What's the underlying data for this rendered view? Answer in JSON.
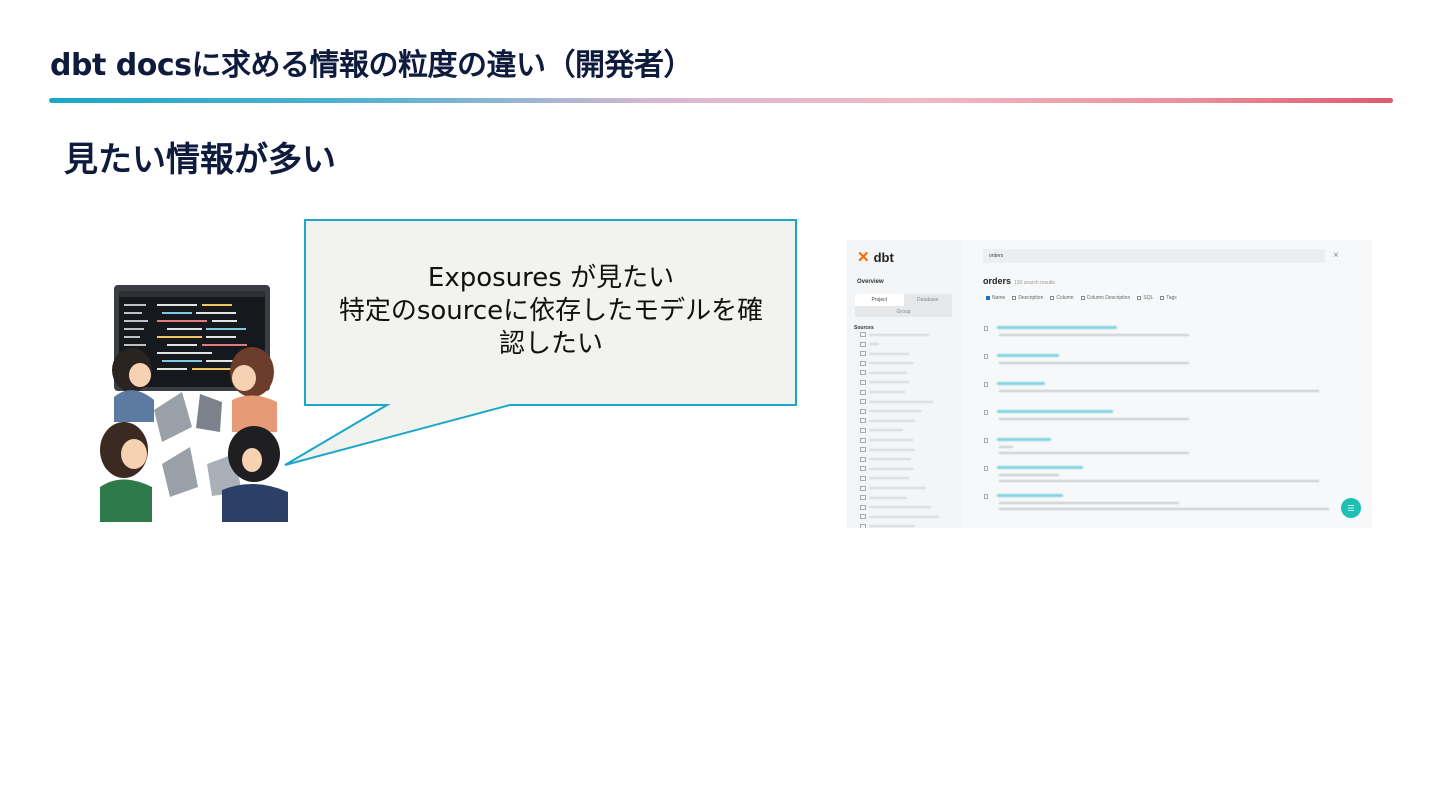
{
  "slide": {
    "title": "dbt docsに求める情報の粒度の違い（開発者）",
    "subtitle": "見たい情報が多い"
  },
  "bubble": {
    "lines": [
      "Exposures が見たい",
      "特定のsourceに依存したモデルを確",
      "認したい"
    ]
  },
  "screenshot": {
    "logo_text": "dbt",
    "sidebar": {
      "overview_label": "Overview",
      "tabs": [
        "Project",
        "Database"
      ],
      "group_label": "Group",
      "sources_label": "Sources"
    },
    "search": {
      "value": "orders"
    },
    "results_title": "orders",
    "results_count": "130 search results",
    "filters": [
      {
        "label": "Name",
        "checked": true
      },
      {
        "label": "Description",
        "checked": false
      },
      {
        "label": "Column",
        "checked": false
      },
      {
        "label": "Column Description",
        "checked": false
      },
      {
        "label": "SQL",
        "checked": false
      },
      {
        "label": "Tags",
        "checked": false
      }
    ]
  },
  "colors": {
    "title_text": "#0f1b3d",
    "bubble_fill": "#f2f2ee",
    "bubble_border": "#1aa7c9",
    "rule_start": "#1aa7c9",
    "rule_end": "#dd5a6e",
    "fab": "#1ec0b4"
  }
}
